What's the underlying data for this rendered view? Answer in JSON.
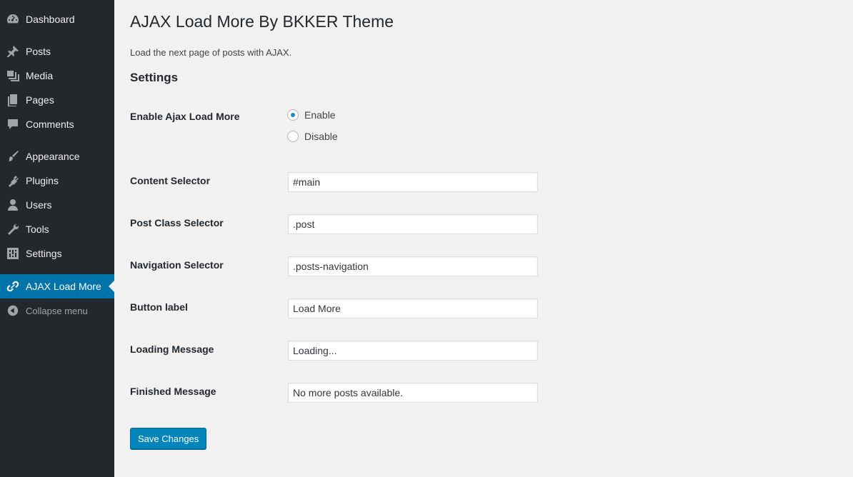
{
  "sidebar": {
    "items": [
      {
        "label": "Dashboard",
        "icon": "dashboard-icon"
      },
      {
        "label": "Posts",
        "icon": "pushpin-icon"
      },
      {
        "label": "Media",
        "icon": "media-icon"
      },
      {
        "label": "Pages",
        "icon": "pages-icon"
      },
      {
        "label": "Comments",
        "icon": "comment-icon"
      },
      {
        "label": "Appearance",
        "icon": "paintbrush-icon"
      },
      {
        "label": "Plugins",
        "icon": "plugin-icon"
      },
      {
        "label": "Users",
        "icon": "user-icon"
      },
      {
        "label": "Tools",
        "icon": "wrench-icon"
      },
      {
        "label": "Settings",
        "icon": "settings-icon"
      },
      {
        "label": "AJAX Load More",
        "icon": "link-icon",
        "active": true
      },
      {
        "label": "Collapse menu",
        "icon": "collapse-icon"
      }
    ]
  },
  "page": {
    "title": "AJAX Load More By BKKER Theme",
    "description": "Load the next page of posts with AJAX.",
    "section_title": "Settings"
  },
  "form": {
    "enable": {
      "label": "Enable Ajax Load More",
      "options": [
        "Enable",
        "Disable"
      ],
      "selected": "Enable"
    },
    "content_selector": {
      "label": "Content Selector",
      "value": "#main"
    },
    "post_class_selector": {
      "label": "Post Class Selector",
      "value": ".post"
    },
    "navigation_selector": {
      "label": "Navigation Selector",
      "value": ".posts-navigation"
    },
    "button_label": {
      "label": "Button label",
      "value": "Load More"
    },
    "loading_message": {
      "label": "Loading Message",
      "value": "Loading..."
    },
    "finished_message": {
      "label": "Finished Message",
      "value": "No more posts available."
    },
    "save_label": "Save Changes"
  },
  "colors": {
    "sidebar_bg": "#23282d",
    "active_bg": "#0073aa",
    "page_bg": "#f1f1f1",
    "primary_button": "#0085ba"
  }
}
